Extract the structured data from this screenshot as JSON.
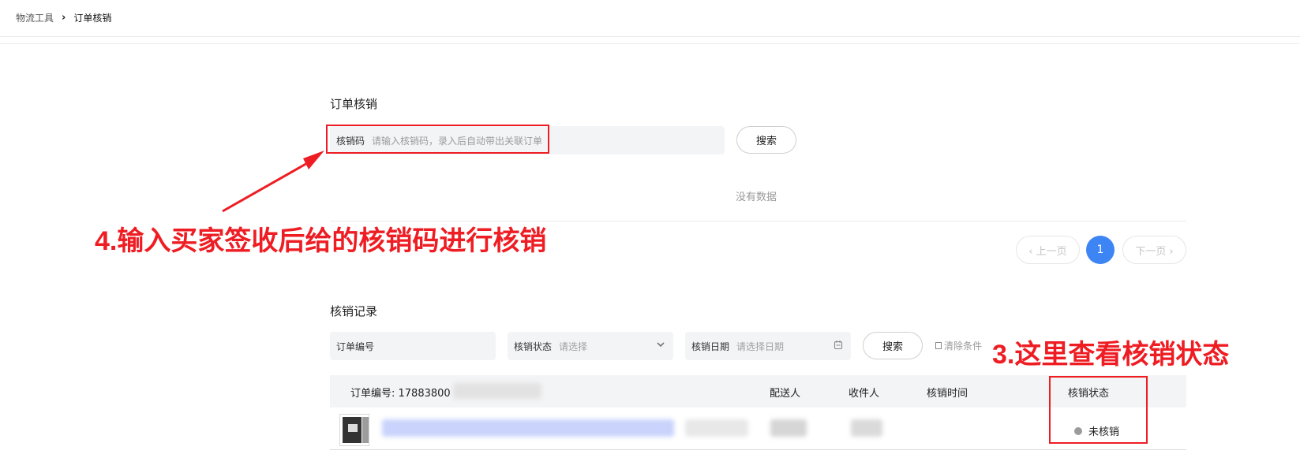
{
  "breadcrumb": {
    "root": "物流工具",
    "separator": "›",
    "current": "订单核销"
  },
  "verify_section": {
    "title": "订单核销",
    "field_label": "核销码",
    "field_placeholder": "请输入核销码，录入后自动带出关联订单",
    "search_button": "搜索",
    "empty_text": "没有数据"
  },
  "pagination": {
    "prev": "‹ 上一页",
    "current_page": "1",
    "next": "下一页 ›"
  },
  "records_section": {
    "title": "核销记录",
    "filters": {
      "order_no_placeholder": "订单编号",
      "status_label": "核销状态",
      "status_placeholder": "请选择",
      "date_label": "核销日期",
      "date_placeholder": "请选择日期"
    },
    "search_button": "搜索",
    "clear_button": "清除条件",
    "table": {
      "order_no_header": "订单编号: 17883800",
      "columns": [
        "配送人",
        "收件人",
        "核销时间",
        "核销状态"
      ],
      "rows": [
        {
          "status": "未核销"
        }
      ]
    }
  },
  "annotations": {
    "step4": "4.输入买家签收后给的核销码进行核销",
    "step3": "3.这里查看核销状态",
    "color": "#ee1d23"
  },
  "colors": {
    "accent": "#3d85f5",
    "field_bg": "#f3f4f6"
  },
  "icons": [
    "chevron-right-icon",
    "chevron-left-icon",
    "chevron-down-icon",
    "calendar-icon"
  ]
}
